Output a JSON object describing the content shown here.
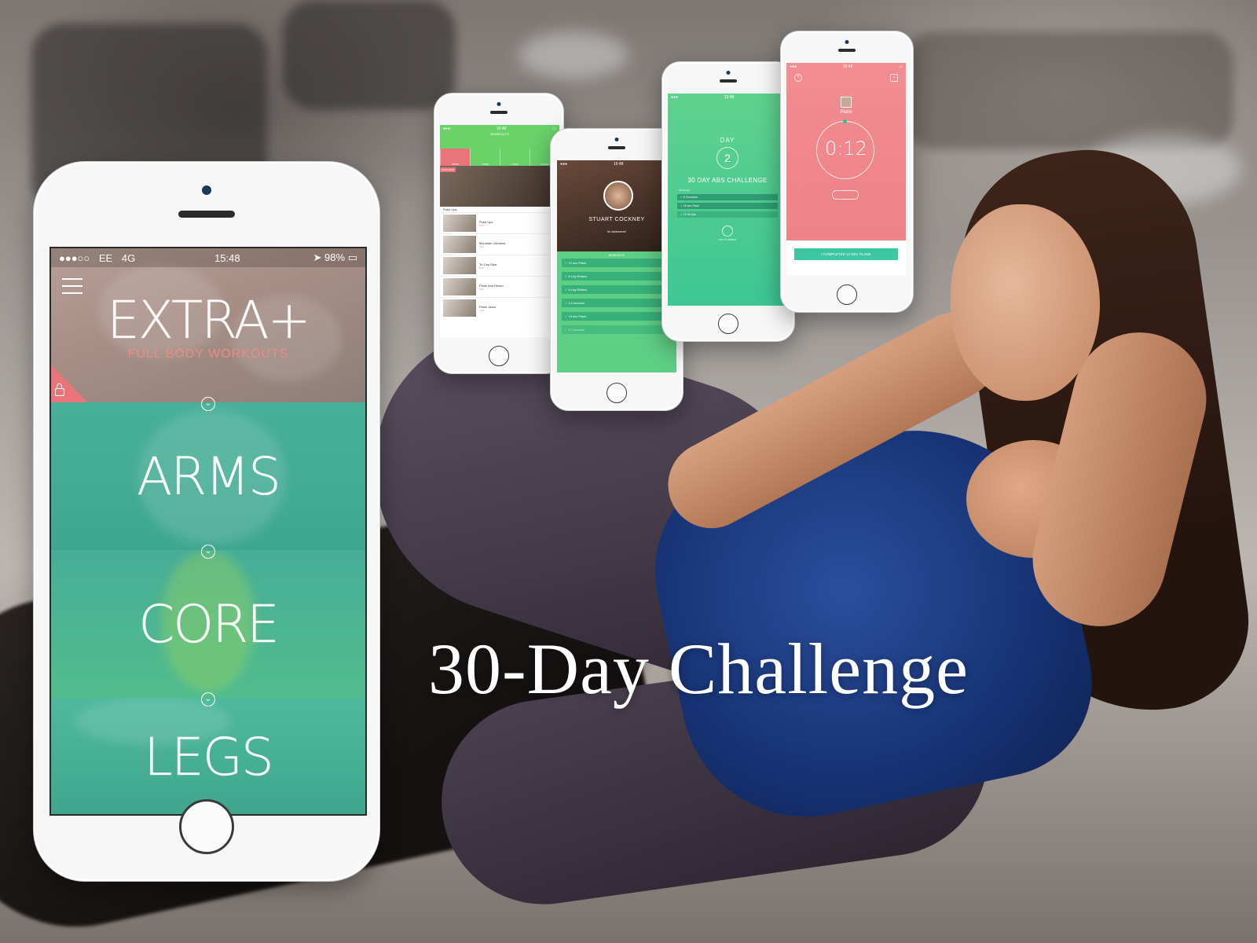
{
  "headline": "30-Day Challenge",
  "main_phone": {
    "status": {
      "carrier": "EE",
      "network": "4G",
      "time": "15:48",
      "battery": "98%"
    },
    "sections": [
      {
        "title": "EXTRA+",
        "subtitle": "FULL BODY WORKOUTS"
      },
      {
        "title": "ARMS"
      },
      {
        "title": "CORE"
      },
      {
        "title": "LEGS"
      }
    ]
  },
  "phone_workouts": {
    "title": "WORKOUTS",
    "tabs": [
      "ARMS",
      "CORE",
      "LEGS",
      "EXTRA"
    ],
    "featured": "FEATURED",
    "list_label": "Push Ups",
    "items": [
      {
        "name": "Push Ups",
        "sub": "0:27"
      },
      {
        "name": "Mountain Climbers",
        "sub": "0:26"
      },
      {
        "name": "Tri-Cep Dips",
        "sub": "0:14"
      },
      {
        "name": "Plank And Reach",
        "sub": "0:26"
      },
      {
        "name": "Plank Jacks",
        "sub": "0:18"
      }
    ]
  },
  "phone_profile": {
    "name": "STUART COCKNEY",
    "status": "Im Awesome!",
    "list_header": "WORKOUTS",
    "items": [
      "12 sec Plank",
      "8 Leg Raises",
      "8 Leg Raises",
      "8 Crunches",
      "15 sec Plank",
      "4 Crunches"
    ]
  },
  "phone_challenge": {
    "day_label": "DAY",
    "day_number": "2",
    "title": "30 DAY ABS CHALLENGE",
    "subtitle": "30 Sit Ups",
    "items": [
      "8 Crunches",
      "15 sec Plank",
      "12 Sit Ups"
    ],
    "tap_label": "TAP TO SUBMIT"
  },
  "phone_timer": {
    "exercise": "Plank",
    "time": "0:12",
    "button": "I COMPLETED 12 SEC PLANK",
    "accent": "#f28d92"
  }
}
